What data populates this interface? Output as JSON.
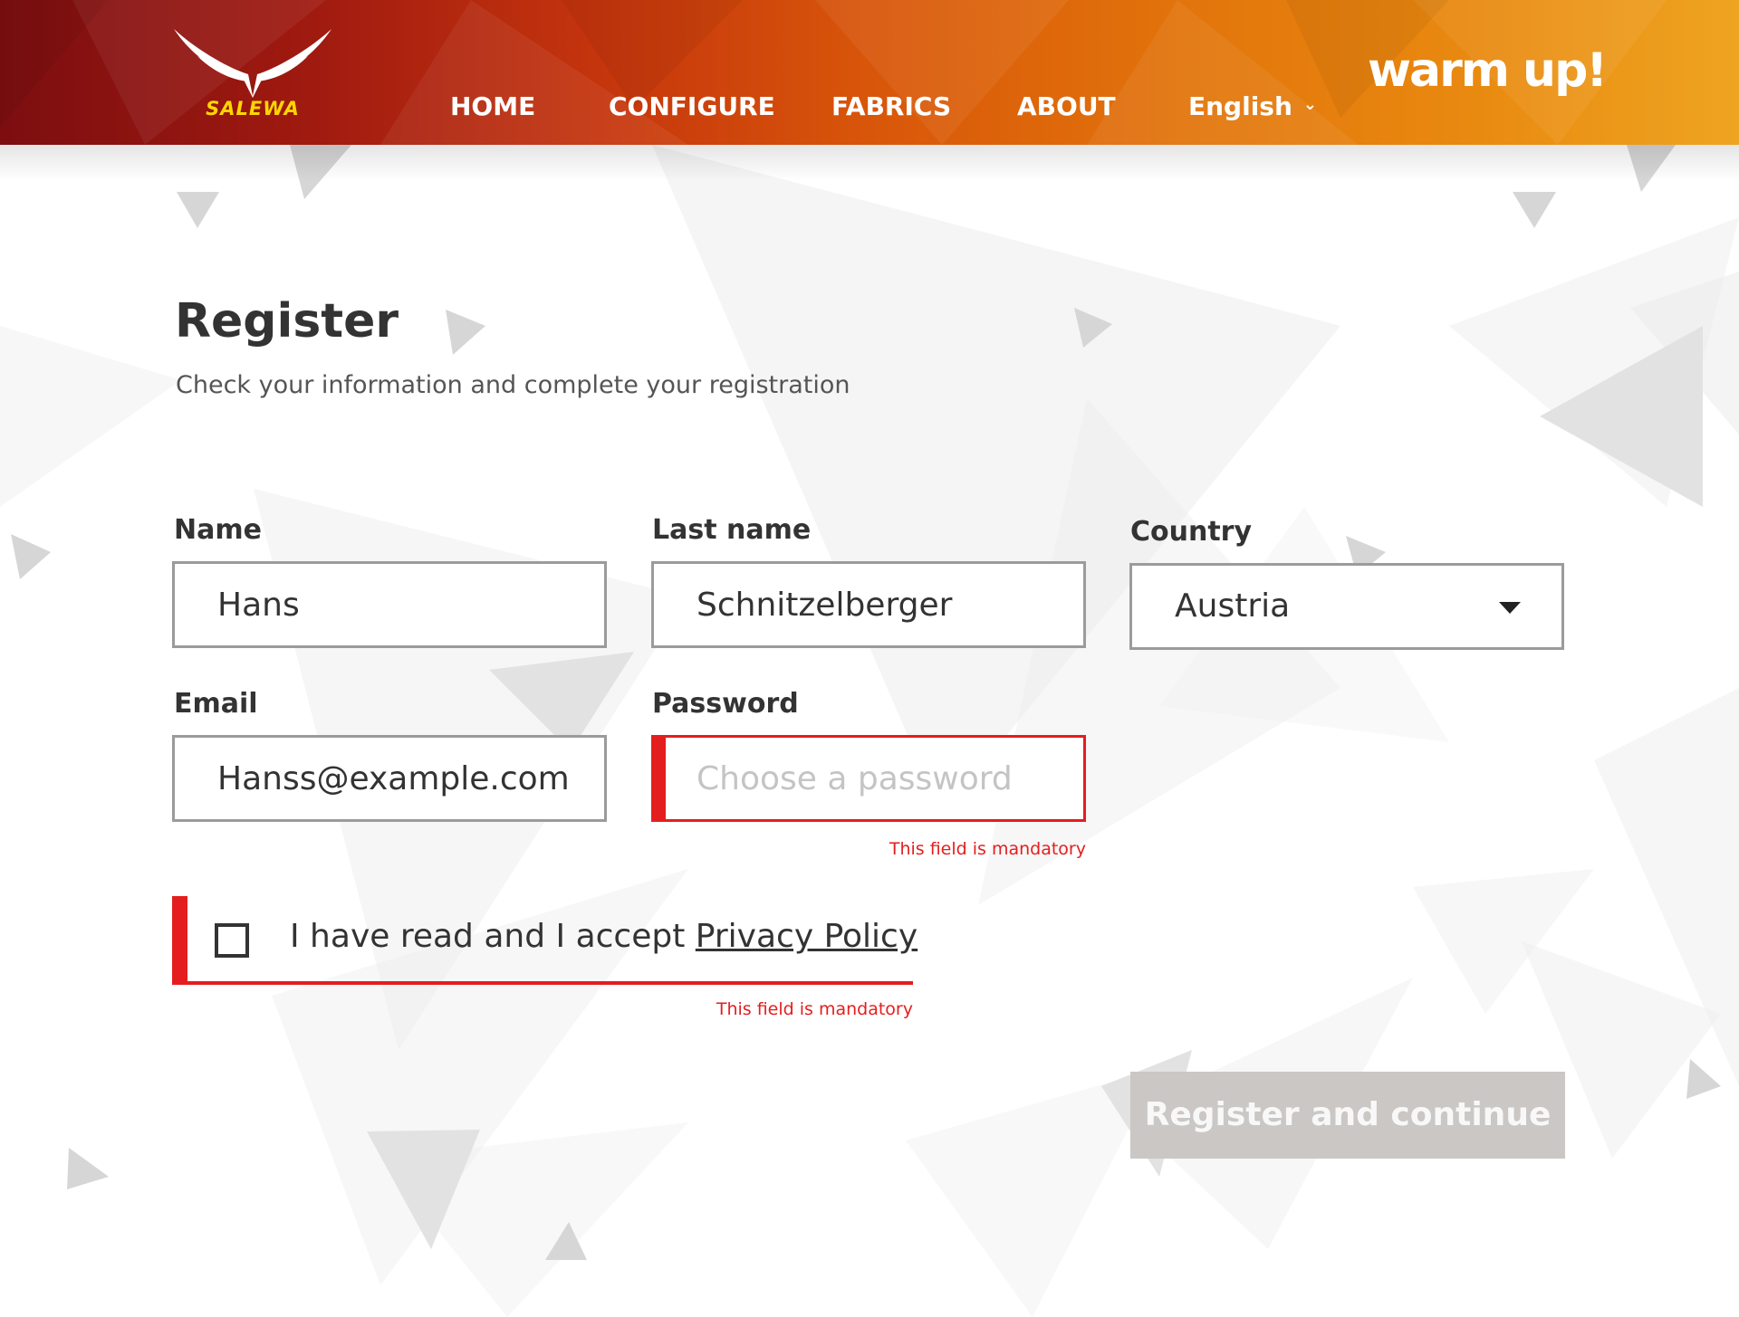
{
  "header": {
    "brand_logo_text": "SALEWA",
    "slogan": "warm up!",
    "nav": [
      {
        "label": "HOME"
      },
      {
        "label": "CONFIGURE"
      },
      {
        "label": "FABRICS"
      },
      {
        "label": "ABOUT"
      }
    ],
    "language": {
      "selected": "English"
    }
  },
  "page": {
    "title": "Register",
    "subtitle": "Check your information and complete your registration"
  },
  "form": {
    "name": {
      "label": "Name",
      "value": "Hans"
    },
    "last_name": {
      "label": "Last name",
      "value": "Schnitzelberger"
    },
    "country": {
      "label": "Country",
      "selected": "Austria"
    },
    "email": {
      "label": "Email",
      "value": "Hanss@example.com"
    },
    "password": {
      "label": "Password",
      "value": "",
      "placeholder": "Choose a password",
      "error": "This field is mandatory"
    },
    "privacy": {
      "text": "I have read and I accept ",
      "link": "Privacy Policy",
      "checked": false,
      "error": "This field is mandatory"
    },
    "submit_label": "Register and continue"
  },
  "colors": {
    "header_gradient_start": "#7c0e10",
    "header_gradient_end": "#eea421",
    "logo_yellow": "#ffd600",
    "error_red": "#e41e1e",
    "button_disabled": "#cac7c5",
    "field_border": "#9b9b9b"
  },
  "icons": {
    "logo": "salewa-eagle-icon",
    "language_dropdown": "chevron-down-icon",
    "country_dropdown": "caret-down-icon"
  }
}
